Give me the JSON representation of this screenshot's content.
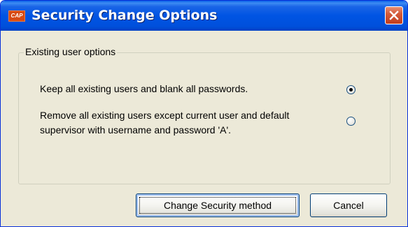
{
  "window": {
    "title": "Security Change Options",
    "app_icon_text": "CAP",
    "accent_color": "#0054e3",
    "close_color": "#c13c1c"
  },
  "group": {
    "legend": "Existing user options",
    "options": [
      {
        "label": "Keep all existing users and blank all passwords.",
        "selected": true
      },
      {
        "label": "Remove all existing users except current user and default supervisor with username and password 'A'.",
        "selected": false
      }
    ]
  },
  "buttons": {
    "change_label": "Change Security method",
    "cancel_label": "Cancel"
  },
  "icons": {
    "app": "cap-app-icon",
    "close": "close-icon"
  }
}
